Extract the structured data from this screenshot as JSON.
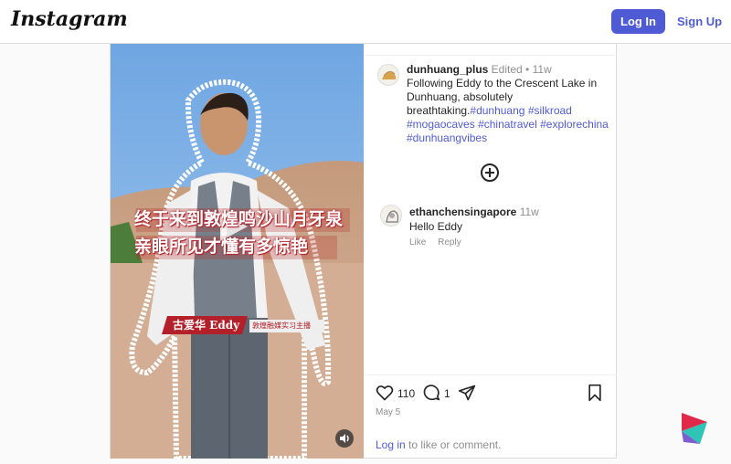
{
  "header": {
    "logo": "Instagram",
    "login_label": "Log In",
    "signup_label": "Sign Up"
  },
  "post": {
    "author": "dunhuang_plus",
    "edited": "Edited",
    "separator": "•",
    "time": "11w",
    "caption": "Following Eddy to the Crescent Lake in Dunhuang, absolutely breathtaking.",
    "hashtags": [
      "#dunhuang",
      "#silkroad",
      "#mogaocaves",
      "#chinatravel",
      "#explorechina",
      "#dunhuangvibes"
    ],
    "likes": "110",
    "comments_count": "1",
    "date": "May 5",
    "login_prompt_link": "Log in",
    "login_prompt_rest": " to like or comment."
  },
  "video": {
    "subtitle_line1": "终于来到敦煌鸣沙山月牙泉",
    "subtitle_line2": "亲眼所见才懂有多惊艳",
    "name_tag": "古爱华 Eddy",
    "role_tag": "敦煌融媒实习主播",
    "play_icon": "play-icon",
    "sound_icon": "sound-icon"
  },
  "comments": [
    {
      "user": "ethanchensingapore",
      "time": "11w",
      "text": "Hello Eddy",
      "like_label": "Like",
      "reply_label": "Reply"
    }
  ],
  "colors": {
    "accent": "#4f5bd5",
    "subtitle_red": "#c0392b",
    "sky": "#7fb3e6",
    "sand": "#caa488"
  }
}
